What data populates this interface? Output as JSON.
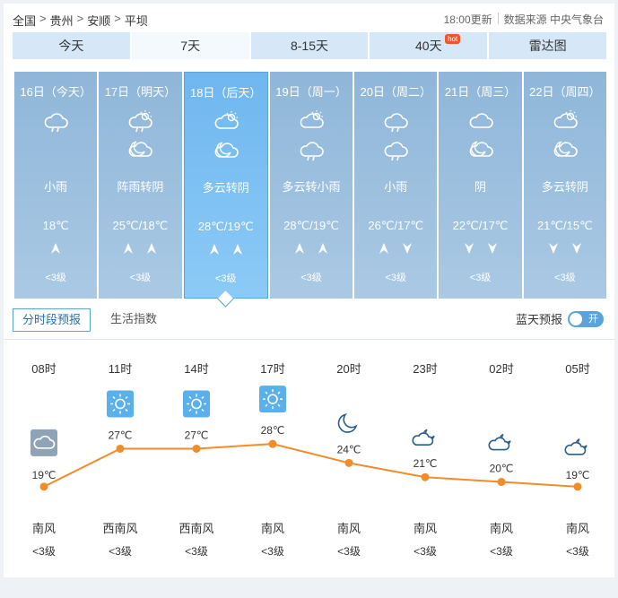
{
  "breadcrumb": [
    "全国",
    "贵州",
    "安顺",
    "平坝"
  ],
  "update_time": "18:00更新",
  "data_source": "数据来源 中央气象台",
  "tabs": [
    {
      "label": "今天"
    },
    {
      "label": "7天",
      "active": true
    },
    {
      "label": "8-15天"
    },
    {
      "label": "40天",
      "badge": "hot"
    },
    {
      "label": "雷达图"
    }
  ],
  "days": [
    {
      "date": "16日（今天）",
      "icon1": "cloud-rain-icon",
      "icon2": "",
      "condition": "小雨",
      "temp": "18℃",
      "wind_dirs": [
        "up"
      ],
      "wind_level": "<3级"
    },
    {
      "date": "17日（明天）",
      "icon1": "sun-cloud-rain-icon",
      "icon2": "moon-cloud-icon",
      "condition": "阵雨转阴",
      "temp": "25℃/18℃",
      "wind_dirs": [
        "up",
        "up"
      ],
      "wind_level": "<3级"
    },
    {
      "date": "18日（后天）",
      "icon1": "sun-cloud-icon",
      "icon2": "moon-cloud-icon",
      "condition": "多云转阴",
      "temp": "28℃/19℃",
      "wind_dirs": [
        "up",
        "up"
      ],
      "wind_level": "<3级",
      "active": true
    },
    {
      "date": "19日（周一）",
      "icon1": "sun-cloud-icon",
      "icon2": "cloud-rain-icon",
      "condition": "多云转小雨",
      "temp": "28℃/19℃",
      "wind_dirs": [
        "up",
        "up"
      ],
      "wind_level": "<3级"
    },
    {
      "date": "20日（周二）",
      "icon1": "cloud-rain-icon",
      "icon2": "cloud-rain-icon",
      "condition": "小雨",
      "temp": "26℃/17℃",
      "wind_dirs": [
        "up",
        "down"
      ],
      "wind_level": "<3级"
    },
    {
      "date": "21日（周三）",
      "icon1": "cloud-icon",
      "icon2": "moon-cloud-icon",
      "condition": "阴",
      "temp": "22℃/17℃",
      "wind_dirs": [
        "down",
        "down"
      ],
      "wind_level": "<3级"
    },
    {
      "date": "22日（周四）",
      "icon1": "sun-cloud-icon",
      "icon2": "moon-cloud-icon",
      "condition": "多云转阴",
      "temp": "21℃/15℃",
      "wind_dirs": [
        "down",
        "down"
      ],
      "wind_level": "<3级"
    }
  ],
  "subtabs": [
    {
      "label": "分时段预报",
      "active": true
    },
    {
      "label": "生活指数"
    }
  ],
  "bluesky": {
    "label": "蓝天预报",
    "toggle_label": "开"
  },
  "colors": {
    "line": "#f28c28",
    "tab_bg": "#d6e8f7",
    "day_bg": "#9bbfe0",
    "day_active": "#7bbff2",
    "accent": "#5aa3db"
  },
  "chart_data": {
    "type": "line",
    "x": [
      "08时",
      "11时",
      "14时",
      "17时",
      "20时",
      "23时",
      "02时",
      "05时"
    ],
    "values": [
      19,
      27,
      27,
      28,
      24,
      21,
      20,
      19
    ],
    "value_labels": [
      "19℃",
      "27℃",
      "27℃",
      "28℃",
      "24℃",
      "21℃",
      "20℃",
      "19℃"
    ],
    "icons": [
      "cloudy-icon",
      "sun-icon",
      "sun-icon",
      "sun-icon",
      "moon-icon",
      "moon-cloud-icon",
      "moon-cloud-icon",
      "moon-cloud-icon"
    ],
    "wind_dirs": [
      "南风",
      "西南风",
      "西南风",
      "南风",
      "南风",
      "南风",
      "南风",
      "南风"
    ],
    "wind_levels": [
      "<3级",
      "<3级",
      "<3级",
      "<3级",
      "<3级",
      "<3级",
      "<3级",
      "<3级"
    ]
  }
}
